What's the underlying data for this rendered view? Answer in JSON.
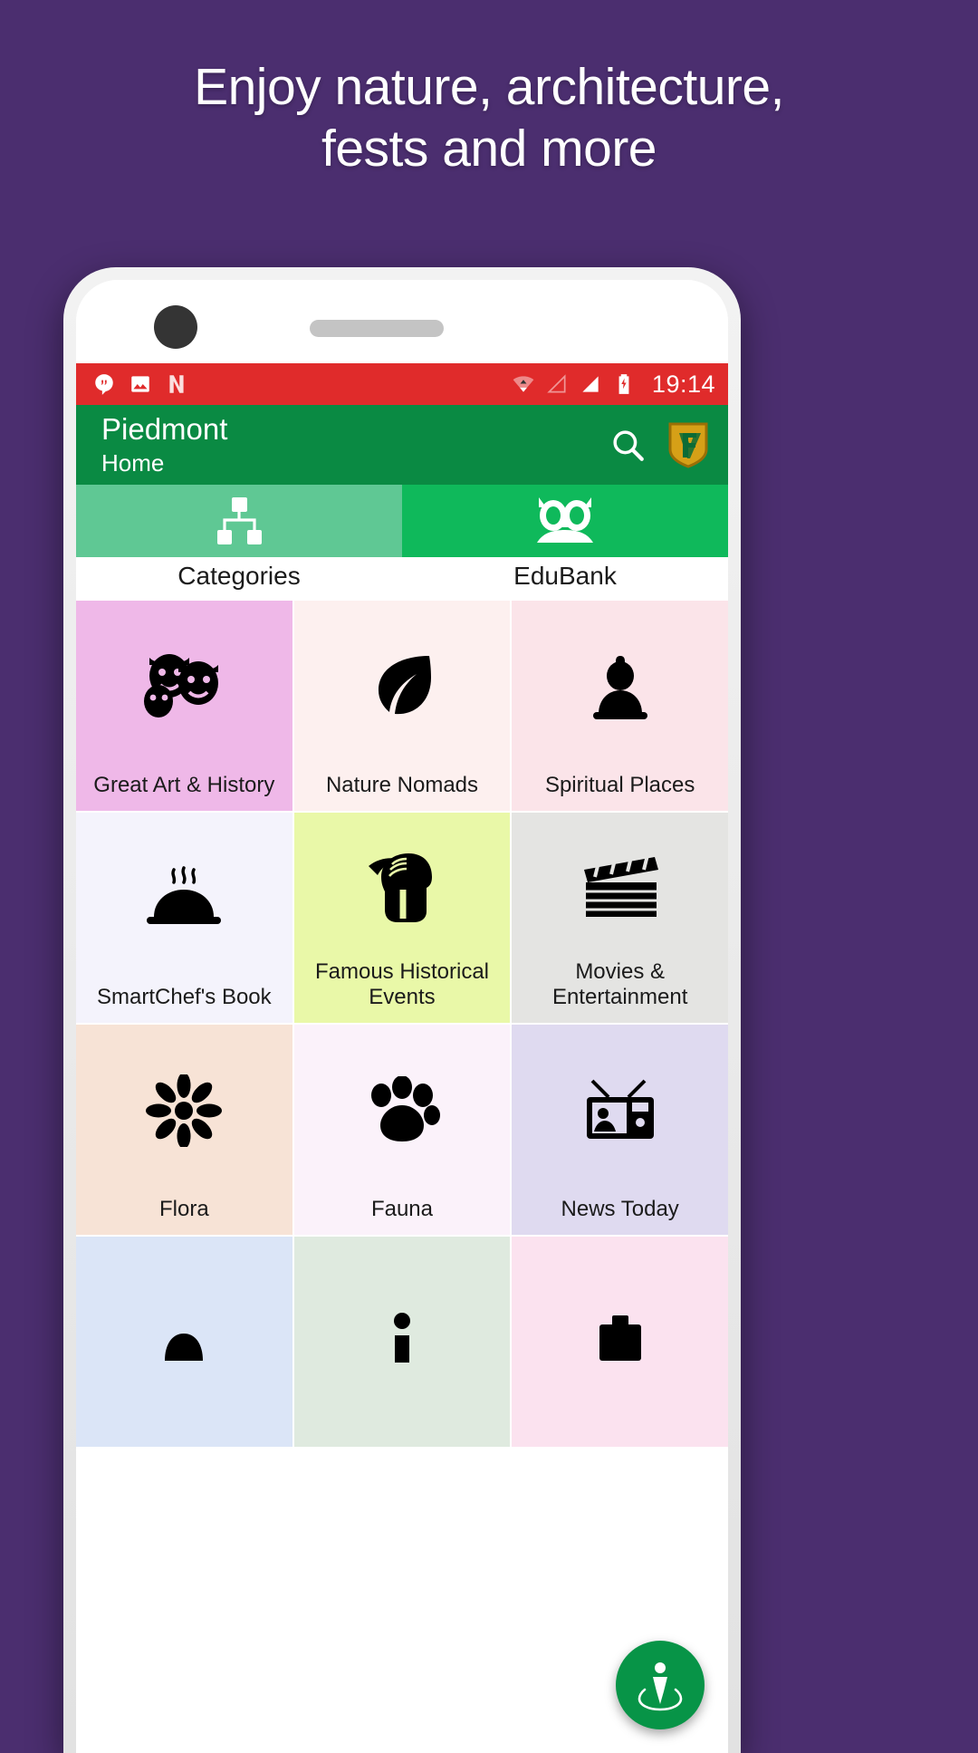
{
  "promo": {
    "line1": "Enjoy nature, architecture,",
    "line2": "fests and more"
  },
  "device": {
    "camera": "front-camera",
    "speaker": "earpiece-speaker"
  },
  "statusbar": {
    "background": "#e02b2b",
    "time": "19:14",
    "icons": [
      {
        "name": "hangouts-notification-icon"
      },
      {
        "name": "photos-notification-icon"
      },
      {
        "name": "nova-notification-icon"
      }
    ],
    "right_icons": [
      {
        "name": "wifi-icon"
      },
      {
        "name": "signal-empty-icon"
      },
      {
        "name": "signal-full-icon"
      },
      {
        "name": "battery-charging-icon"
      }
    ]
  },
  "appbar": {
    "background": "#0a8a43",
    "title": "Piedmont",
    "subtitle": "Home",
    "search_icon": "search-icon",
    "logo_icon": "shield-logo-icon"
  },
  "tabs": [
    {
      "label": "Categories",
      "icon": "sitemap-icon",
      "color": "#5fc894",
      "selected": true
    },
    {
      "label": "EduBank",
      "icon": "owl-icon",
      "color": "#0fb95b",
      "selected": false
    }
  ],
  "grid": {
    "tiles": [
      {
        "label": "Great Art & History",
        "icon": "theatre-masks-icon",
        "bg": "#efb8e8"
      },
      {
        "label": "Nature Nomads",
        "icon": "leaf-icon",
        "bg": "#fdf0ef"
      },
      {
        "label": "Spiritual Places",
        "icon": "buddha-icon",
        "bg": "#fbe4e9"
      },
      {
        "label": "SmartChef's Book",
        "icon": "cloche-icon",
        "bg": "#f4f3fc"
      },
      {
        "label": "Famous Historical Events",
        "icon": "spartan-helmet-icon",
        "bg": "#e9f8a8"
      },
      {
        "label": "Movies & Entertainment",
        "icon": "clapperboard-icon",
        "bg": "#e4e4e2"
      },
      {
        "label": "Flora",
        "icon": "flower-icon",
        "bg": "#f7e3d6"
      },
      {
        "label": "Fauna",
        "icon": "paw-icon",
        "bg": "#fbf2fa"
      },
      {
        "label": "News Today",
        "icon": "television-icon",
        "bg": "#dfdaf0"
      },
      {
        "label": "",
        "icon": "partial-tile-icon",
        "bg": "#dbe5f7"
      },
      {
        "label": "",
        "icon": "partial-tile-icon",
        "bg": "#dfeadf"
      },
      {
        "label": "",
        "icon": "partial-tile-icon",
        "bg": "#fbe2ef"
      }
    ]
  },
  "fab": {
    "icon": "person-location-icon",
    "color": "#079447"
  }
}
